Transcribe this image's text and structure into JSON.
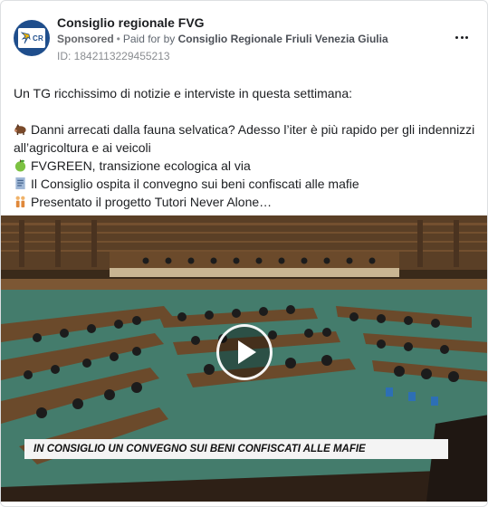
{
  "post": {
    "page_name": "Consiglio regionale FVG",
    "avatar_text": "CR",
    "sponsored_label": "Sponsored",
    "separator": "•",
    "paid_for_prefix": "Paid for by",
    "payer": "Consiglio Regionale Friuli Venezia Giulia",
    "ad_id": "ID: 1842113229455213",
    "body": {
      "intro": "Un TG ricchissimo di notizie e interviste in questa settimana:",
      "item1_line1": "Danni arrecati dalla fauna selvatica? Adesso l’iter è più rapido per gli indennizzi",
      "item1_line2": "all’agricoltura e ai veicoli",
      "item2": "FVGREEN, transizione ecologica al via",
      "item3": "Il Consiglio ospita il convegno sui beni confiscati alle mafie",
      "item4": "Presentato il progetto Tutori Never Alone…"
    },
    "video": {
      "caption": "IN CONSIGLIO UN CONVEGNO SUI BENI CONFISCATI ALLE MAFIE"
    }
  },
  "icons": {
    "item1": "boar-icon",
    "item2": "green-apple-icon",
    "item3": "document-icon",
    "item4": "people-icon",
    "more": "more-horizontal-icon",
    "play": "play-icon"
  },
  "colors": {
    "avatar_bg": "#1f4e8c",
    "text_primary": "#1c1e21",
    "text_secondary": "#606770",
    "carpet": "#4d8a78",
    "wood": "#6b4a2b"
  }
}
